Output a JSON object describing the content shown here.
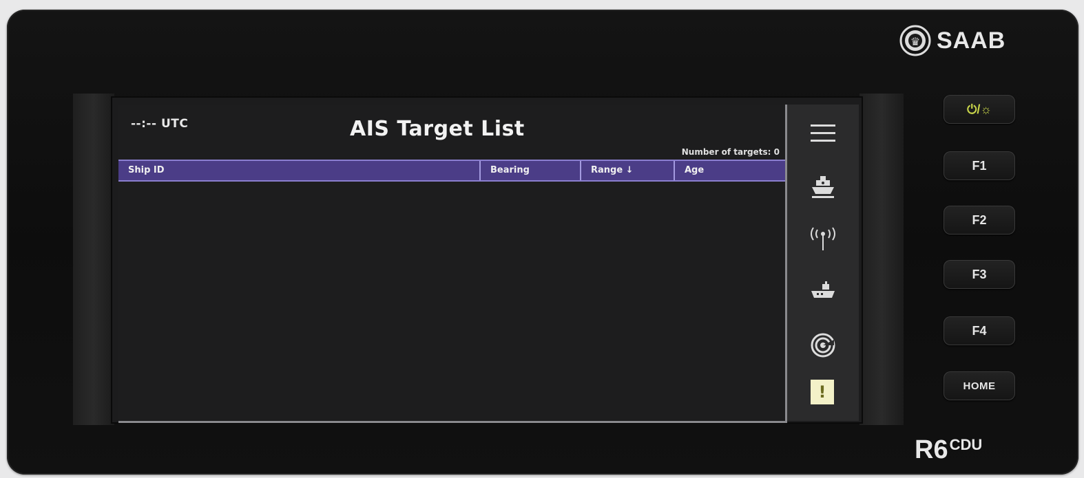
{
  "brand": "SAAB",
  "model": {
    "main": "R6",
    "sub": "CDU"
  },
  "screen": {
    "utc": "--:-- UTC",
    "title": "AIS Target List",
    "target_count": "Number of targets: 0",
    "columns": [
      "Ship ID",
      "Bearing",
      "Range ↓",
      "Age"
    ],
    "rows": []
  },
  "sidebar": {
    "items": [
      {
        "icon": "menu-icon"
      },
      {
        "icon": "ship-targets-icon"
      },
      {
        "icon": "antenna-icon"
      },
      {
        "icon": "vessel-icon"
      },
      {
        "icon": "radar-icon"
      },
      {
        "icon": "alert-icon",
        "label": "!"
      }
    ]
  },
  "hardware_buttons": {
    "power": "⏻/☼",
    "f1": "F1",
    "f2": "F2",
    "f3": "F3",
    "f4": "F4",
    "home": "HOME"
  },
  "colors": {
    "header": "#4b3d87",
    "alert": "#f3f1c8",
    "power": "#c9d64a"
  }
}
